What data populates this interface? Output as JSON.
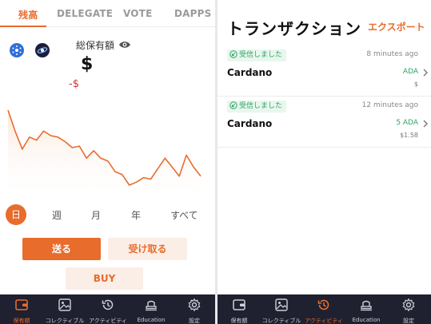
{
  "wallet": {
    "tabs": [
      "残高",
      "DELEGATE",
      "VOTE",
      "DAPPS"
    ],
    "balance_label": "総保有額",
    "balance_value": "$",
    "balance_change": "-$",
    "periods": [
      "日",
      "週",
      "月",
      "年",
      "すべて"
    ],
    "send_label": "送る",
    "receive_label": "受け取る",
    "buy_label": "BUY"
  },
  "chart_data": {
    "type": "area",
    "x": [
      1,
      2,
      3,
      4,
      5,
      6,
      7,
      8,
      9,
      10,
      11,
      12,
      13,
      14,
      15,
      16,
      17,
      18,
      19,
      20,
      21,
      22,
      23,
      24,
      25,
      26,
      27,
      28,
      29,
      30
    ],
    "values": [
      100,
      86,
      74,
      82,
      80,
      86,
      83,
      82,
      79,
      75,
      76,
      68,
      73,
      68,
      66,
      59,
      57,
      50,
      52,
      55,
      54,
      61,
      68,
      62,
      56,
      70,
      62,
      56
    ],
    "title": "",
    "xlabel": "",
    "ylabel": "",
    "grid": false,
    "line_color": "#e86c2c"
  },
  "nav": {
    "items": [
      {
        "label": "保有額",
        "icon": "wallet-icon"
      },
      {
        "label": "コレクティブル",
        "icon": "image-icon"
      },
      {
        "label": "アクティビティ",
        "icon": "history-icon"
      },
      {
        "label": "Education",
        "icon": "education-icon"
      },
      {
        "label": "設定",
        "icon": "gear-icon"
      }
    ],
    "active_left": 0,
    "active_right": 2
  },
  "transactions": {
    "title": "トランザクション",
    "export_label": "エクスポート",
    "items": [
      {
        "status": "受信しました",
        "time": "8 minutes ago",
        "asset": "Cardano",
        "amount": "ADA",
        "fiat": "$"
      },
      {
        "status": "受信しました",
        "time": "12 minutes ago",
        "asset": "Cardano",
        "amount": "5 ADA",
        "fiat": "$1.58"
      }
    ]
  },
  "colors": {
    "accent": "#e86c2c",
    "success": "#2fa463",
    "negative": "#d32f2f",
    "nav_bg": "#1f2030"
  }
}
